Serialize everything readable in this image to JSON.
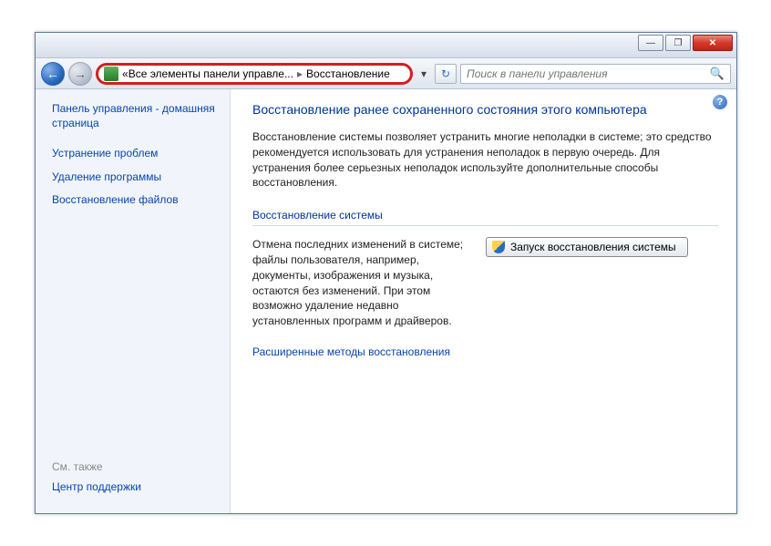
{
  "titlebar": {
    "minimize": "—",
    "maximize": "❐",
    "close": "✕"
  },
  "nav": {
    "back": "←",
    "forward": "→",
    "chevrons": "«",
    "seg1": "Все элементы панели управле...",
    "sep": "▸",
    "seg2": "Восстановление",
    "dropdown": "▾",
    "refresh": "↻"
  },
  "search": {
    "placeholder": "Поиск в панели управления",
    "icon": "🔍"
  },
  "sidebar": {
    "home": "Панель управления - домашняя страница",
    "troubleshoot": "Устранение проблем",
    "uninstall": "Удаление программы",
    "file_recovery": "Восстановление файлов",
    "see_also_label": "См. также",
    "action_center": "Центр поддержки"
  },
  "help": "?",
  "main": {
    "heading": "Восстановление ранее сохраненного состояния этого компьютера",
    "description": "Восстановление системы позволяет устранить многие неполадки в системе; это средство рекомендуется использовать для устранения неполадок в первую очередь. Для устранения более серьезных неполадок используйте дополнительные способы восстановления.",
    "section_title": "Восстановление системы",
    "restore_desc": "Отмена последних изменений в системе; файлы пользователя, например, документы, изображения и музыка, остаются без изменений. При этом возможно удаление недавно установленных программ и драйверов.",
    "restore_btn": "Запуск восстановления системы",
    "advanced_link": "Расширенные методы восстановления"
  }
}
